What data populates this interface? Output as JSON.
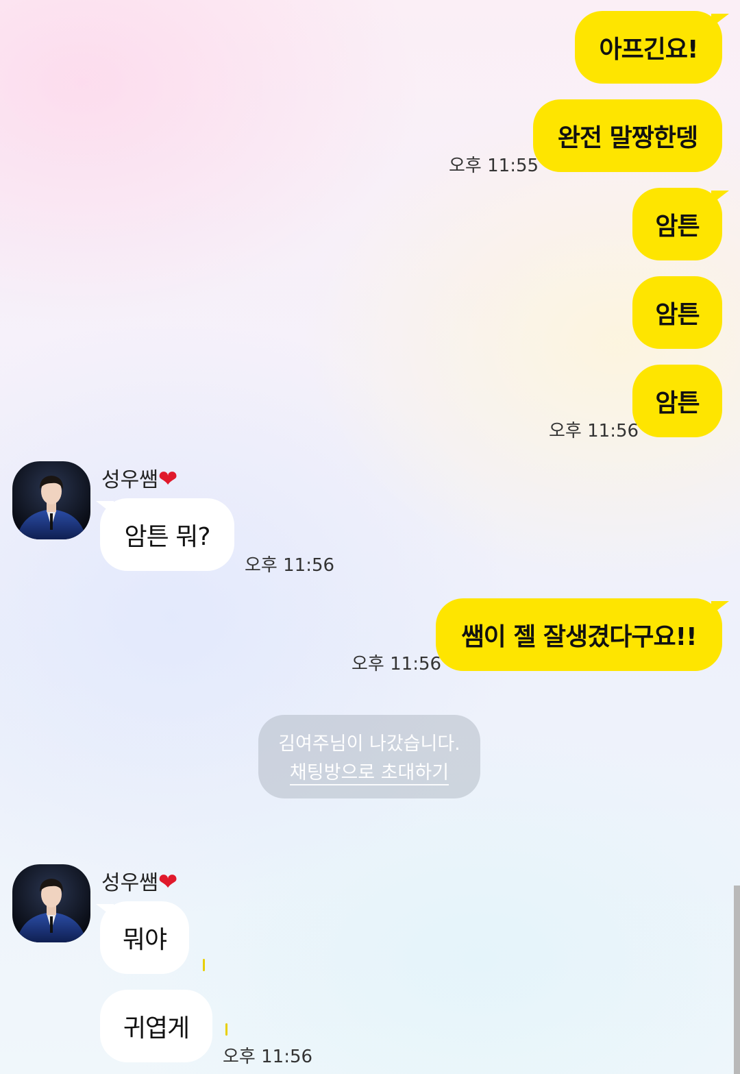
{
  "colors": {
    "my_bubble": "#fee500",
    "their_bubble": "#ffffff",
    "heart": "#e0192b"
  },
  "messages_block1": {
    "m1": "아프긴요!",
    "m2": "완전 말짱한뎅",
    "m2_time": "오후 11:55",
    "m3": "암튼",
    "m4": "암튼",
    "m5": "암튼",
    "m5_time": "오후 11:56"
  },
  "sender": {
    "name": "성우쌤",
    "emoji": "❤"
  },
  "messages_block2": {
    "m1": "암튼 뭐?",
    "m1_time": "오후 11:56",
    "m2": "쌤이 젤 잘생겼다구요!!",
    "m2_time": "오후 11:56"
  },
  "system_notice": {
    "left_text": "김여주님이 나갔습니다.",
    "invite_link": "채팅방으로 초대하기"
  },
  "messages_block3": {
    "m1": "뭐야",
    "m2": "귀엽게",
    "m2_time": "오후 11:56"
  }
}
